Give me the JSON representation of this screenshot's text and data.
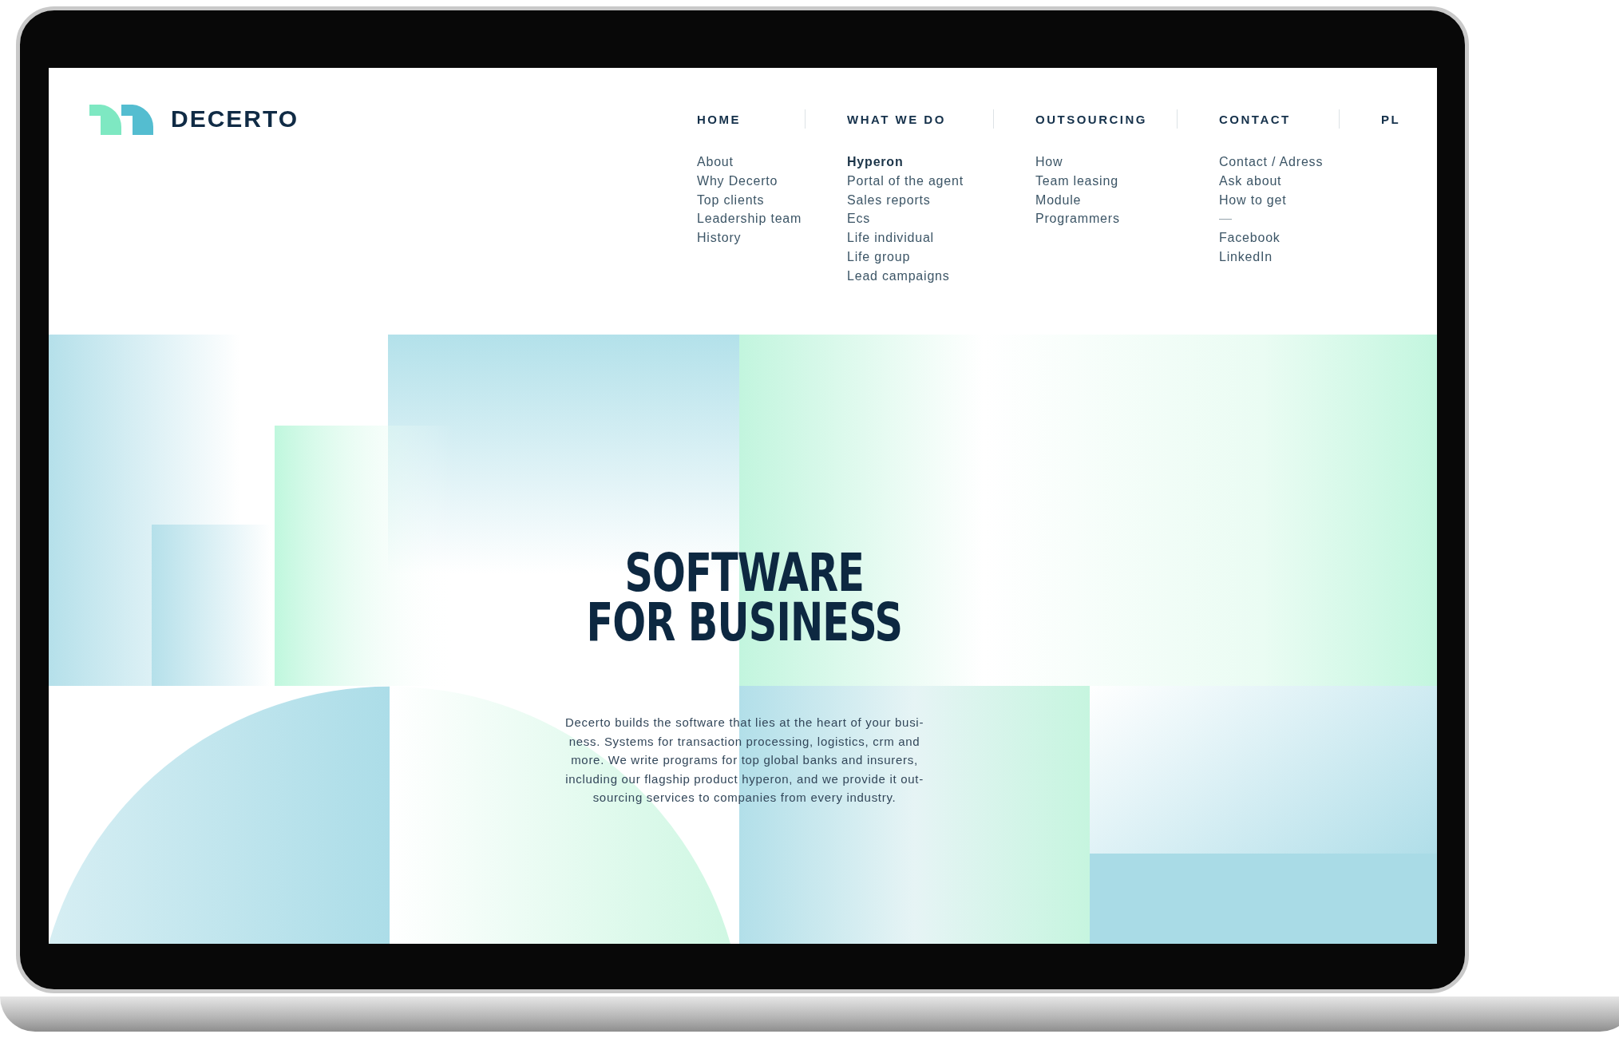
{
  "logo": {
    "text": "DECERTO"
  },
  "nav": [
    {
      "label": "HOME",
      "items": [
        {
          "text": "About",
          "kind": "link"
        },
        {
          "text": "Why Decerto",
          "kind": "link"
        },
        {
          "text": "Top clients",
          "kind": "link"
        },
        {
          "text": "Leadership team",
          "kind": "link"
        },
        {
          "text": "History",
          "kind": "link"
        }
      ]
    },
    {
      "label": "WHAT WE DO",
      "items": [
        {
          "text": "Hyperon",
          "kind": "heading"
        },
        {
          "text": "Portal of the agent",
          "kind": "link"
        },
        {
          "text": "Sales reports",
          "kind": "link"
        },
        {
          "text": "Ecs",
          "kind": "link"
        },
        {
          "text": "Life individual",
          "kind": "link"
        },
        {
          "text": "Life group",
          "kind": "link"
        },
        {
          "text": "Lead campaigns",
          "kind": "link"
        }
      ]
    },
    {
      "label": "OUTSOURCING",
      "items": [
        {
          "text": "How",
          "kind": "link"
        },
        {
          "text": "Team leasing",
          "kind": "link"
        },
        {
          "text": "Module",
          "kind": "link"
        },
        {
          "text": "Programmers",
          "kind": "link"
        }
      ]
    },
    {
      "label": "CONTACT",
      "items": [
        {
          "text": "Contact / Adress",
          "kind": "link"
        },
        {
          "text": "Ask about",
          "kind": "link"
        },
        {
          "text": "How to get",
          "kind": "link"
        },
        {
          "text": "—",
          "kind": "separator"
        },
        {
          "text": "Facebook",
          "kind": "link"
        },
        {
          "text": "LinkedIn",
          "kind": "link"
        }
      ]
    }
  ],
  "language": "PL",
  "hero": {
    "title_lines": [
      "SOFTWARE",
      "FOR BUSINESS"
    ],
    "paragraph_lines": [
      "Decerto builds the software that lies at the heart of your busi-",
      "ness. Systems for transaction processing, logistics, crm and",
      "more. We write programs for top global banks and insurers,",
      "including our flagship product hyperon, and we provide it out-",
      "sourcing services to companies from every industry."
    ]
  }
}
